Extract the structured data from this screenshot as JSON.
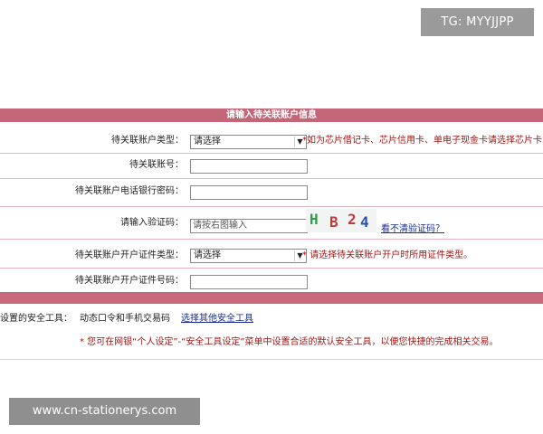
{
  "watermarks": {
    "top": "TG: MYYJJPP",
    "bottom": "www.cn-stationerys.com"
  },
  "form": {
    "header": "请输入待关联账户信息",
    "account_type": {
      "label": "待关联账户类型：",
      "value": "请选择",
      "note": "*如为芯片借记卡、芯片信用卡、单电子现金卡请选择芯片卡"
    },
    "account_number": {
      "label": "待关联账号：",
      "value": ""
    },
    "phone_bank_password": {
      "label": "待关联账户电话银行密码：",
      "value": ""
    },
    "captcha": {
      "label": "请输入验证码：",
      "placeholder": "请按右图输入",
      "chars": [
        "H",
        "B",
        "2",
        "4"
      ],
      "unclear_link": "看不清验证码？"
    },
    "id_type": {
      "label": "待关联账户开户证件类型：",
      "value": "请选择",
      "note_star": "*",
      "note": "请选择待关联账户开户时所用证件类型。"
    },
    "id_number": {
      "label": "待关联账户开户证件号码：",
      "value": ""
    }
  },
  "security": {
    "label": "设置的安全工具：",
    "value": "动态口令和手机交易码",
    "link": "选择其他安全工具",
    "tip": "* 您可在网银“个人设定”-“安全工具设定”菜单中设置合适的默认安全工具，以便您快捷的完成相关交易。"
  },
  "colors": {
    "header_bg": "#c26678",
    "note_red": "#a01818",
    "link_blue": "#1b2f8f",
    "captcha_green": "#2e9a4a",
    "captcha_red": "#c23a3a",
    "captcha_blue": "#2f4fb0"
  }
}
